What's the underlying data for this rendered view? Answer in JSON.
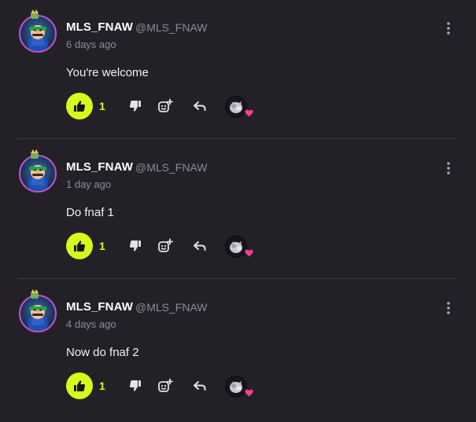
{
  "colors": {
    "background": "#232127",
    "accent_like": "#d6fa1b",
    "avatar_border": "#c052c9",
    "muted_text": "#8e8a96",
    "heart": "#ff3e93"
  },
  "icons": {
    "more": "vertical-ellipsis-icon",
    "like": "thumbs-up-icon",
    "dislike": "thumbs-down-icon",
    "react": "add-emoji-icon",
    "reply": "reply-arrow-icon",
    "reaction_badge": "heart-icon"
  },
  "comments": [
    {
      "username": "MLS_FNAW",
      "handle": "@MLS_FNAW",
      "time": "6 days ago",
      "text": "You're welcome",
      "likes": "1"
    },
    {
      "username": "MLS_FNAW",
      "handle": "@MLS_FNAW",
      "time": "1 day ago",
      "text": "Do fnaf 1",
      "likes": "1"
    },
    {
      "username": "MLS_FNAW",
      "handle": "@MLS_FNAW",
      "time": "4 days ago",
      "text": "Now do fnaf 2",
      "likes": "1"
    }
  ]
}
